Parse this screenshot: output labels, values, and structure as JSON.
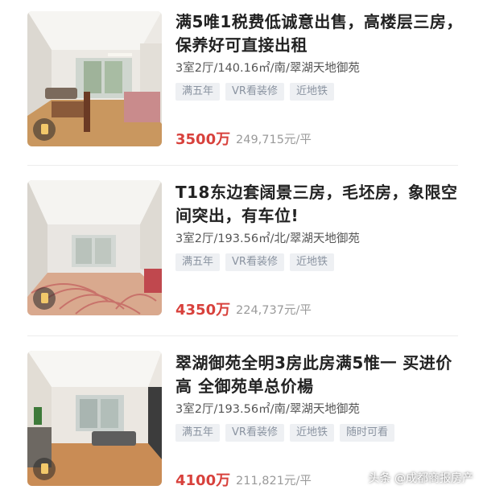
{
  "listings": [
    {
      "title": "满5唯1税费低诚意出售，高楼层三房，保养好可直接出租",
      "meta": "3室2厅/140.16㎡/南/翠湖天地御苑",
      "tags": [
        "满五年",
        "VR看装修",
        "近地铁"
      ],
      "price": "3500万",
      "unit_price": "249,715元/平"
    },
    {
      "title": "T18东边套阔景三房，毛坯房，象限空间突出，有车位!",
      "meta": "3室2厅/193.56㎡/北/翠湖天地御苑",
      "tags": [
        "满五年",
        "VR看装修",
        "近地铁"
      ],
      "price": "4350万",
      "unit_price": "224,737元/平"
    },
    {
      "title": "翠湖御苑全明3房此房满5惟一 买进价高 全御苑单总价楊",
      "meta": "3室2厅/193.56㎡/南/翠湖天地御苑",
      "tags": [
        "满五年",
        "VR看装修",
        "近地铁",
        "随时可看"
      ],
      "price": "4100万",
      "unit_price": "211,821元/平"
    }
  ],
  "watermark": "头条 @成都商报房产"
}
